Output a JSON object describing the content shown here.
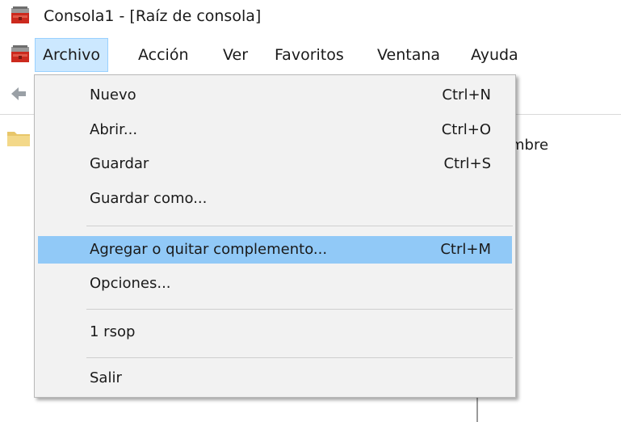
{
  "window": {
    "title": "Consola1 - [Raíz de consola]"
  },
  "menubar": {
    "items": [
      {
        "label": "Archivo"
      },
      {
        "label": "Acción"
      },
      {
        "label": "Ver"
      },
      {
        "label": "Favoritos"
      },
      {
        "label": "Ventana"
      },
      {
        "label": "Ayuda"
      }
    ],
    "active_index": 0
  },
  "right_pane": {
    "column_header_fragment": "mbre"
  },
  "file_menu": {
    "items": [
      {
        "label": "Nuevo",
        "shortcut": "Ctrl+N"
      },
      {
        "label": "Abrir...",
        "shortcut": "Ctrl+O"
      },
      {
        "label": "Guardar",
        "shortcut": "Ctrl+S"
      },
      {
        "label": "Guardar como...",
        "shortcut": ""
      },
      {
        "label": "Agregar o quitar complemento...",
        "shortcut": "Ctrl+M"
      },
      {
        "label": "Opciones...",
        "shortcut": ""
      },
      {
        "label": "1 rsop",
        "shortcut": ""
      },
      {
        "label": "Salir",
        "shortcut": ""
      }
    ],
    "highlighted_index": 4
  },
  "colors": {
    "menu_active_bg": "#cce8ff",
    "dropdown_bg": "#f2f2f2",
    "highlight_bg": "#91c9f7"
  },
  "icons": {
    "app": "mmc-toolbox-icon",
    "back": "back-arrow-icon",
    "folder": "folder-icon"
  }
}
